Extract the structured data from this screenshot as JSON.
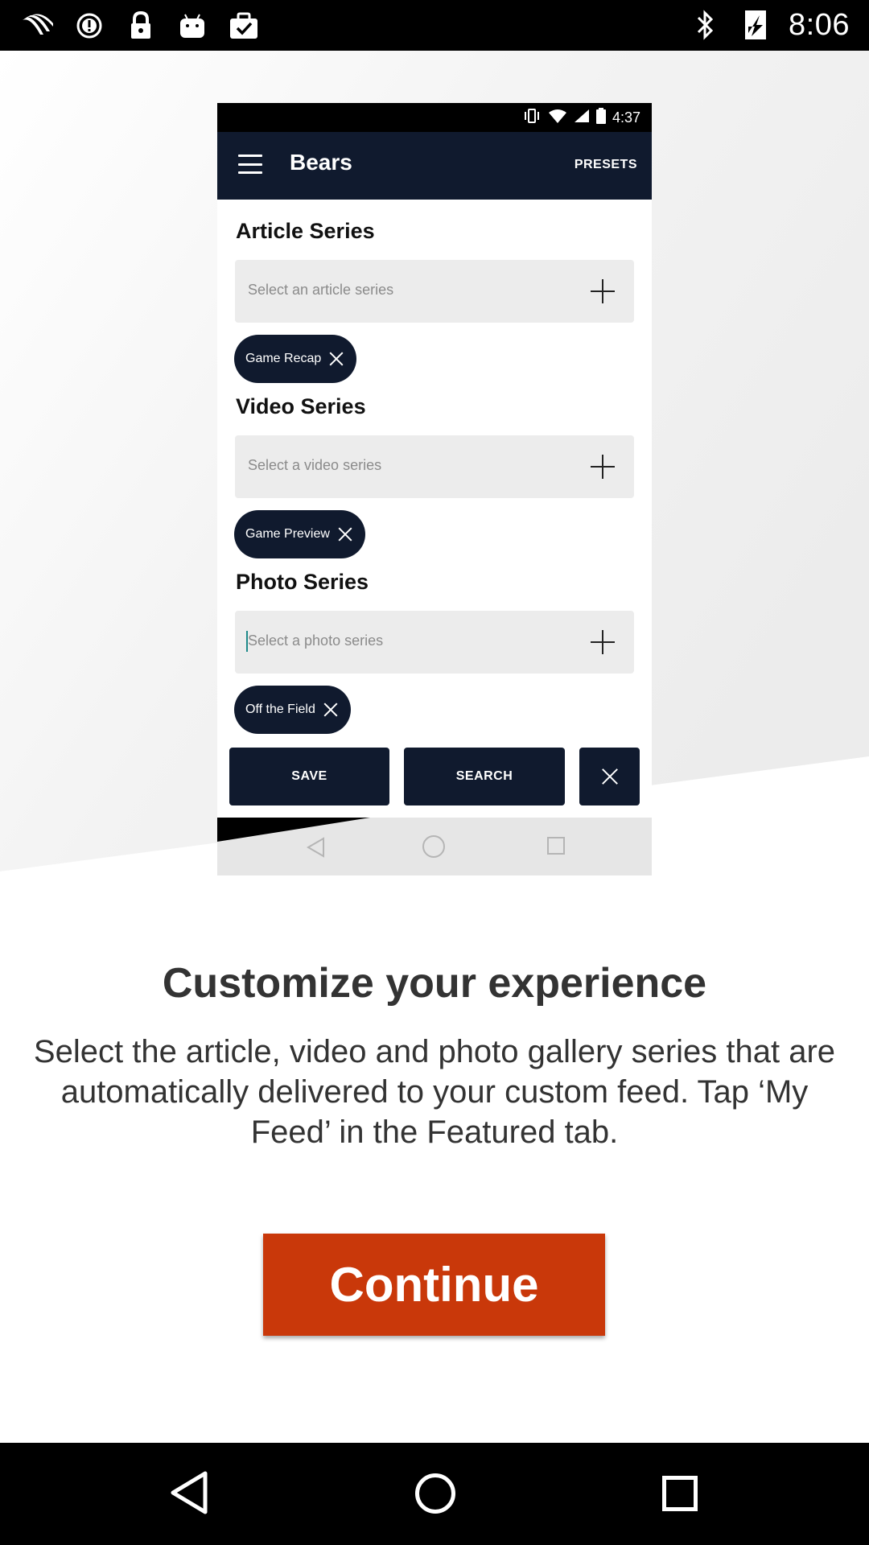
{
  "status_bar": {
    "time": "8:06",
    "left_icons": [
      "fan-icon",
      "alert-icon",
      "lock-icon",
      "android-icon",
      "clipboard-check-icon"
    ],
    "right_icons": [
      "bluetooth-icon",
      "network-icon"
    ]
  },
  "preview": {
    "status_time": "4:37",
    "app_title": "Bears",
    "presets_label": "PRESETS",
    "sections": [
      {
        "title": "Article Series",
        "placeholder": "Select an article series",
        "chip": "Game Recap"
      },
      {
        "title": "Video Series",
        "placeholder": "Select a video series",
        "chip": "Game Preview"
      },
      {
        "title": "Photo Series",
        "placeholder": "Select a photo series",
        "chip": "Off the Field"
      }
    ],
    "save_label": "SAVE",
    "search_label": "SEARCH"
  },
  "onboarding": {
    "headline": "Customize your experience",
    "description": "Select the article, video and photo gallery series that are automatically delivered to your custom feed. Tap ‘My Feed’ in the Featured tab.",
    "continue_label": "Continue"
  },
  "colors": {
    "navy": "#101a2e",
    "accent": "#c9380a",
    "text": "#333333"
  }
}
